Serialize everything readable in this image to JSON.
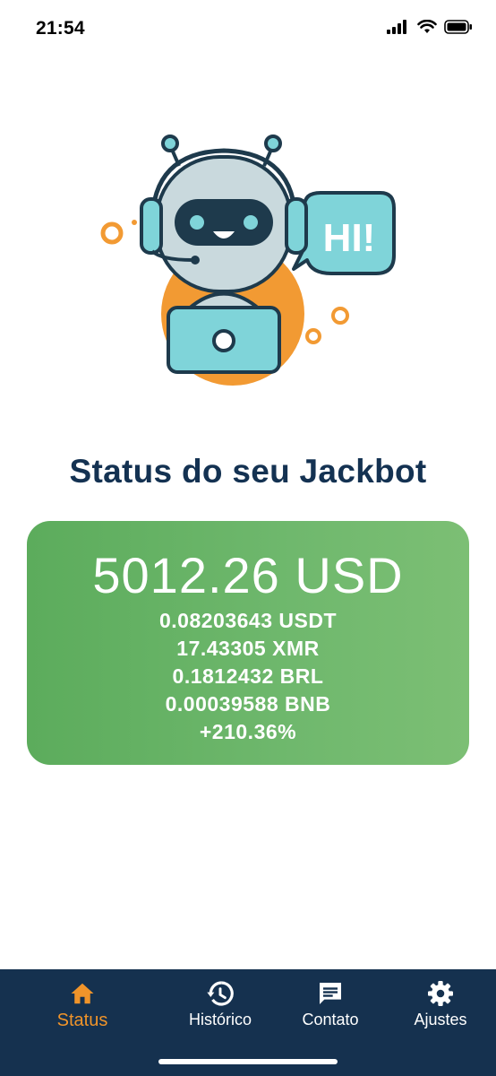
{
  "status_bar": {
    "time": "21:54"
  },
  "hero": {
    "bubble_text": "HI!"
  },
  "title": "Status do seu Jackbot",
  "balance": {
    "main": "5012.26 USD",
    "lines": [
      "0.08203643 USDT",
      "17.43305 XMR",
      "0.1812432 BRL",
      "0.00039588 BNB",
      "+210.36%"
    ]
  },
  "tabs": [
    {
      "label": "Status",
      "icon": "home-icon",
      "active": true
    },
    {
      "label": "Histórico",
      "icon": "history-icon",
      "active": false
    },
    {
      "label": "Contato",
      "icon": "chat-icon",
      "active": false
    },
    {
      "label": "Ajustes",
      "icon": "gear-icon",
      "active": false
    }
  ],
  "colors": {
    "title": "#143252",
    "card_green": "#6fb86d",
    "tabbar": "#15314f",
    "active_tab": "#f0942a",
    "robot_teal": "#7fd4d9",
    "robot_orange": "#f29a33"
  }
}
